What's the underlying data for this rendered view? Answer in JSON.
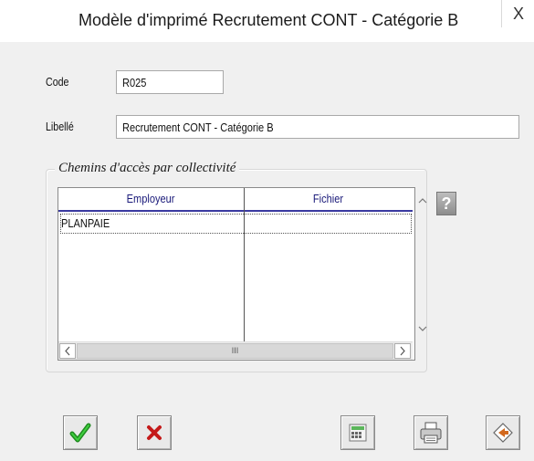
{
  "window": {
    "title": "Modèle d'imprimé Recrutement CONT - Catégorie B",
    "close_label": "X"
  },
  "form": {
    "code_label": "Code",
    "code_value": "R025",
    "libelle_label": "Libellé",
    "libelle_value": "Recrutement CONT - Catégorie B"
  },
  "group": {
    "title": "Chemins d'accès par collectivité",
    "columns": [
      "Employeur",
      "Fichier"
    ],
    "rows": [
      {
        "employeur": "PLANPAIE",
        "fichier": ""
      }
    ],
    "hscroll_thumb": "III"
  },
  "help_label": "?",
  "toolbar": {
    "buttons": [
      "validate-icon",
      "cancel-icon",
      "calculator-icon",
      "printer-icon",
      "export-icon"
    ]
  }
}
